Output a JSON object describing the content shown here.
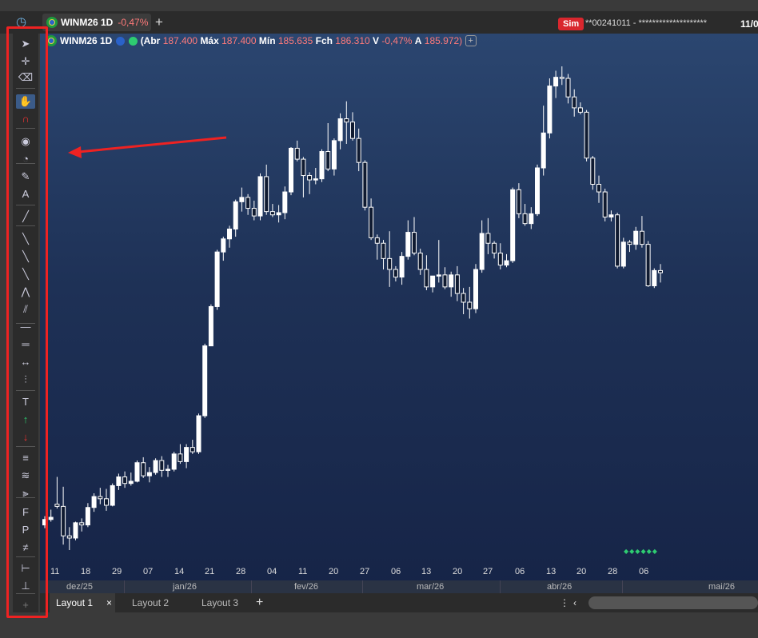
{
  "topbar": {
    "tab_symbol": "WINM26 1D",
    "tab_change": "-0,47%",
    "add_tab": "+",
    "sim_badge": "Sim",
    "account": "**00241011 - ********************",
    "date": "11/0"
  },
  "infobar": {
    "symbol": "WINM26 1D",
    "open_label": "(Abr",
    "open": "187.400",
    "max_label": "Máx",
    "max": "187.400",
    "min_label": "Mín",
    "min": "185.635",
    "close_label": "Fch",
    "close": "186.310",
    "var_label": "V",
    "var": "-0,47%",
    "a_label": "A",
    "a_value": "185.972)",
    "add": "+"
  },
  "toolbar": {
    "tools": [
      "pointer",
      "crosshair",
      "eraser",
      "hand",
      "magnet",
      "eye",
      "timer",
      "pencil",
      "text-box",
      "brush",
      "line",
      "segment",
      "ray",
      "polyline",
      "parallel",
      "horizontal-line",
      "double-line",
      "measure",
      "volume-profile",
      "text",
      "arrow-up",
      "arrow-down",
      "channel",
      "fibonacci-c",
      "fan",
      "fibonacci-f",
      "pitchfork-p",
      "fibonacci-time",
      "range-measure",
      "anchor",
      "add"
    ]
  },
  "chart": {
    "volume_dots": "◆◆◆◆◆◆",
    "x_ticks": [
      "11",
      "18",
      "29",
      "07",
      "14",
      "21",
      "28",
      "04",
      "11",
      "20",
      "27",
      "06",
      "13",
      "20",
      "27",
      "06",
      "13",
      "20",
      "28",
      "06"
    ],
    "months": [
      "dez/25",
      "jan/26",
      "fev/26",
      "mar/26",
      "abr/26",
      "mai/26"
    ]
  },
  "chart_data": {
    "type": "candlestick",
    "note_units": "index points (thousands)",
    "candles": [
      [
        158.6,
        159.4,
        158.3,
        159.1
      ],
      [
        159.1,
        160.0,
        158.9,
        159.3
      ],
      [
        160.5,
        163.0,
        160.1,
        160.3
      ],
      [
        160.3,
        162.1,
        156.8,
        157.6
      ],
      [
        157.6,
        158.4,
        156.3,
        157.4
      ],
      [
        157.4,
        158.9,
        157.2,
        158.8
      ],
      [
        158.8,
        159.2,
        158.0,
        158.6
      ],
      [
        158.6,
        160.6,
        158.4,
        160.2
      ],
      [
        160.2,
        161.5,
        159.8,
        161.2
      ],
      [
        161.2,
        162.0,
        160.5,
        161.0
      ],
      [
        161.0,
        161.9,
        159.9,
        160.4
      ],
      [
        160.4,
        162.4,
        160.3,
        162.2
      ],
      [
        162.2,
        163.3,
        161.8,
        163.0
      ],
      [
        163.0,
        163.5,
        162.0,
        162.4
      ],
      [
        162.4,
        163.4,
        162.2,
        162.6
      ],
      [
        162.6,
        164.5,
        162.5,
        164.3
      ],
      [
        164.3,
        164.8,
        162.9,
        163.1
      ],
      [
        163.1,
        163.9,
        162.5,
        163.4
      ],
      [
        163.4,
        164.7,
        163.2,
        164.5
      ],
      [
        164.5,
        164.9,
        163.0,
        163.6
      ],
      [
        163.6,
        164.1,
        163.0,
        163.7
      ],
      [
        163.7,
        165.3,
        163.5,
        165.1
      ],
      [
        165.1,
        166.0,
        164.2,
        164.4
      ],
      [
        164.4,
        166.0,
        163.8,
        165.7
      ],
      [
        165.7,
        166.4,
        165.1,
        165.3
      ],
      [
        165.3,
        168.8,
        165.1,
        168.6
      ],
      [
        168.6,
        175.2,
        168.4,
        175.0
      ],
      [
        175.0,
        178.8,
        175.0,
        178.6
      ],
      [
        178.6,
        183.8,
        178.3,
        183.6
      ],
      [
        183.6,
        185.0,
        182.8,
        184.8
      ],
      [
        184.8,
        186.0,
        184.0,
        185.7
      ],
      [
        185.7,
        188.4,
        185.0,
        188.2
      ],
      [
        188.2,
        189.5,
        187.3,
        188.6
      ],
      [
        188.6,
        188.9,
        187.0,
        187.6
      ],
      [
        187.6,
        188.3,
        186.5,
        186.9
      ],
      [
        186.9,
        190.8,
        186.5,
        190.5
      ],
      [
        190.5,
        191.6,
        187.0,
        187.3
      ],
      [
        187.3,
        188.0,
        186.8,
        187.0
      ],
      [
        187.0,
        187.9,
        186.3,
        187.2
      ],
      [
        187.2,
        189.6,
        186.6,
        189.1
      ],
      [
        189.1,
        193.2,
        188.8,
        193.1
      ],
      [
        193.1,
        193.8,
        191.9,
        192.1
      ],
      [
        192.1,
        192.3,
        188.6,
        190.6
      ],
      [
        190.6,
        190.9,
        188.9,
        190.2
      ],
      [
        190.2,
        191.3,
        189.8,
        190.3
      ],
      [
        190.3,
        193.0,
        190.0,
        192.8
      ],
      [
        192.8,
        195.4,
        191.0,
        191.2
      ],
      [
        191.2,
        194.0,
        190.6,
        193.8
      ],
      [
        193.8,
        196.3,
        193.0,
        195.8
      ],
      [
        195.8,
        197.4,
        193.5,
        195.5
      ],
      [
        195.5,
        196.4,
        193.8,
        194.0
      ],
      [
        194.0,
        194.9,
        191.0,
        191.8
      ],
      [
        191.8,
        192.0,
        187.4,
        187.7
      ],
      [
        187.7,
        188.5,
        184.7,
        184.9
      ],
      [
        184.9,
        185.2,
        182.9,
        184.4
      ],
      [
        184.4,
        184.7,
        182.0,
        183.0
      ],
      [
        183.0,
        185.5,
        180.4,
        182.0
      ],
      [
        182.0,
        182.3,
        180.9,
        181.3
      ],
      [
        181.3,
        183.6,
        180.6,
        183.2
      ],
      [
        183.2,
        186.5,
        182.9,
        185.4
      ],
      [
        185.4,
        186.8,
        183.3,
        183.5
      ],
      [
        183.5,
        183.9,
        181.5,
        182.0
      ],
      [
        182.0,
        183.3,
        180.1,
        180.4
      ],
      [
        180.4,
        181.3,
        179.9,
        181.4
      ],
      [
        181.4,
        184.7,
        180.8,
        181.5
      ],
      [
        181.5,
        182.2,
        180.2,
        180.4
      ],
      [
        180.4,
        181.8,
        179.5,
        181.5
      ],
      [
        181.5,
        182.3,
        179.1,
        179.8
      ],
      [
        179.8,
        180.3,
        177.9,
        179.0
      ],
      [
        179.0,
        180.4,
        177.5,
        178.4
      ],
      [
        178.4,
        182.5,
        178.0,
        182.0
      ],
      [
        182.0,
        186.5,
        181.7,
        185.3
      ],
      [
        185.3,
        186.7,
        183.4,
        184.4
      ],
      [
        184.4,
        184.6,
        183.0,
        183.5
      ],
      [
        183.5,
        184.4,
        182.0,
        182.4
      ],
      [
        182.4,
        183.4,
        182.2,
        182.8
      ],
      [
        182.8,
        189.5,
        182.6,
        189.3
      ],
      [
        189.3,
        189.9,
        186.7,
        187.1
      ],
      [
        187.1,
        188.0,
        186.0,
        186.2
      ],
      [
        186.2,
        187.7,
        185.7,
        187.1
      ],
      [
        187.1,
        191.6,
        186.9,
        191.3
      ],
      [
        191.3,
        197.0,
        190.6,
        194.5
      ],
      [
        194.5,
        199.5,
        194.0,
        198.8
      ],
      [
        198.8,
        200.2,
        197.7,
        199.6
      ],
      [
        199.6,
        200.6,
        198.9,
        199.5
      ],
      [
        199.5,
        199.9,
        197.2,
        197.8
      ],
      [
        197.8,
        198.5,
        196.0,
        196.8
      ],
      [
        196.8,
        197.3,
        196.2,
        196.4
      ],
      [
        196.4,
        196.6,
        191.9,
        192.2
      ],
      [
        192.2,
        192.4,
        189.3,
        189.8
      ],
      [
        189.8,
        190.6,
        188.1,
        189.1
      ],
      [
        189.1,
        189.4,
        186.4,
        186.8
      ],
      [
        186.8,
        187.4,
        186.4,
        187.0
      ],
      [
        187.0,
        187.2,
        182.1,
        182.3
      ],
      [
        182.3,
        184.9,
        182.1,
        184.5
      ],
      [
        184.5,
        184.7,
        183.6,
        184.3
      ],
      [
        184.3,
        185.9,
        183.8,
        185.5
      ],
      [
        185.5,
        186.9,
        184.0,
        184.3
      ],
      [
        184.3,
        184.6,
        180.4,
        180.5
      ],
      [
        180.5,
        182.1,
        180.3,
        181.9
      ],
      [
        181.9,
        182.5,
        180.8,
        181.7
      ]
    ]
  }
}
